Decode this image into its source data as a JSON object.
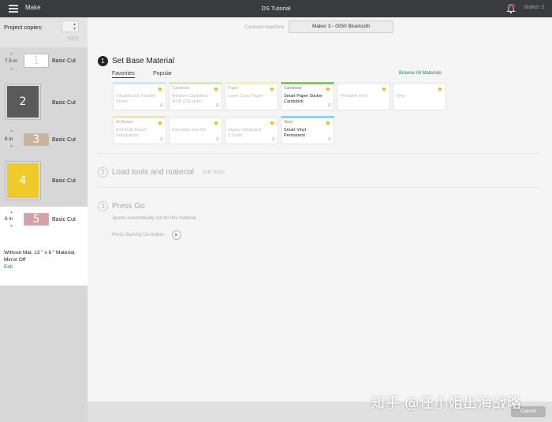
{
  "topbar": {
    "app_title": "Make",
    "doc_title": "DS Tutorial",
    "user_name": "Maker 3",
    "icons": [
      "menu-icon",
      "bell-icon"
    ]
  },
  "sidebar": {
    "copies_label": "Project copies:",
    "copies_value": "",
    "copies_apply": "Apply",
    "mats": [
      {
        "size": "7.5 in",
        "number": "1",
        "label": "Basic Cut",
        "color": "#ffffff"
      },
      {
        "size": "",
        "number": "2",
        "label": "Basic Cut",
        "color": "#5a5a5a"
      },
      {
        "size": "6 in",
        "number": "3",
        "label": "Basic Cut",
        "color": "#c8b49a"
      },
      {
        "size": "",
        "number": "4",
        "label": "Basic Cut",
        "color": "#eecb2a"
      },
      {
        "size": "6 in",
        "number": "5",
        "label": "Basic Cut",
        "color": "#d4a0a5"
      }
    ],
    "mat_note": "Without Mat, 13 \" x 6 \" Material, Mirror Off",
    "mat_edit": "Edit"
  },
  "main": {
    "connect_label": "Connect machine",
    "connect_value": "Maker 3 - 0050 Bluetooth",
    "step1": {
      "number": "1",
      "title": "Set Base Material",
      "tabs": [
        "Favorites",
        "Popular"
      ],
      "browse_all": "Browse All Materials",
      "cards": [
        {
          "category": "",
          "name": "Infusible Ink Transfer Sheet",
          "color": "#cfe7f2",
          "highlight": false
        },
        {
          "category": "Cardstock",
          "name": "Medium Cardstock - 80 lb (216 gsm)",
          "color": "#d6e8c8",
          "highlight": false
        },
        {
          "category": "Paper",
          "name": "Laser Copy Paper",
          "color": "#f4efc8",
          "highlight": false
        },
        {
          "category": "Cardstock",
          "name": "Smart Paper Sticker Cardstock",
          "color": "#8cc06c",
          "highlight": true
        },
        {
          "category": "",
          "name": "Printable Vinyl",
          "color": "#f0f0f0",
          "highlight": false
        },
        {
          "category": "",
          "name": "Vinyl",
          "color": "#f0f0f0",
          "highlight": false
        },
        {
          "category": "Art Board",
          "name": "Foil Kraft Board - Holographic",
          "color": "#efe3c6",
          "highlight": false
        },
        {
          "category": "",
          "name": "Everyday Iron-On",
          "color": "#f0f0f0",
          "highlight": false
        },
        {
          "category": "",
          "name": "Heavy Chipboard - 2.0 mm",
          "color": "#f0f0f0",
          "highlight": false
        },
        {
          "category": "Vinyl",
          "name": "Smart Vinyl - Permanent",
          "color": "#8fd3e8",
          "highlight": true
        }
      ]
    },
    "step2": {
      "number": "2",
      "title": "Load tools and material",
      "edit_tools": "Edit Tools"
    },
    "step3": {
      "number": "3",
      "title": "Press Go",
      "sub1": "Speed automatically set for this material.",
      "sub2": "Press flashing Go button.",
      "go_icon": "play-icon"
    }
  },
  "footer": {
    "cancel": "Cancel"
  },
  "watermark": "知乎 @任小姐出海战略"
}
